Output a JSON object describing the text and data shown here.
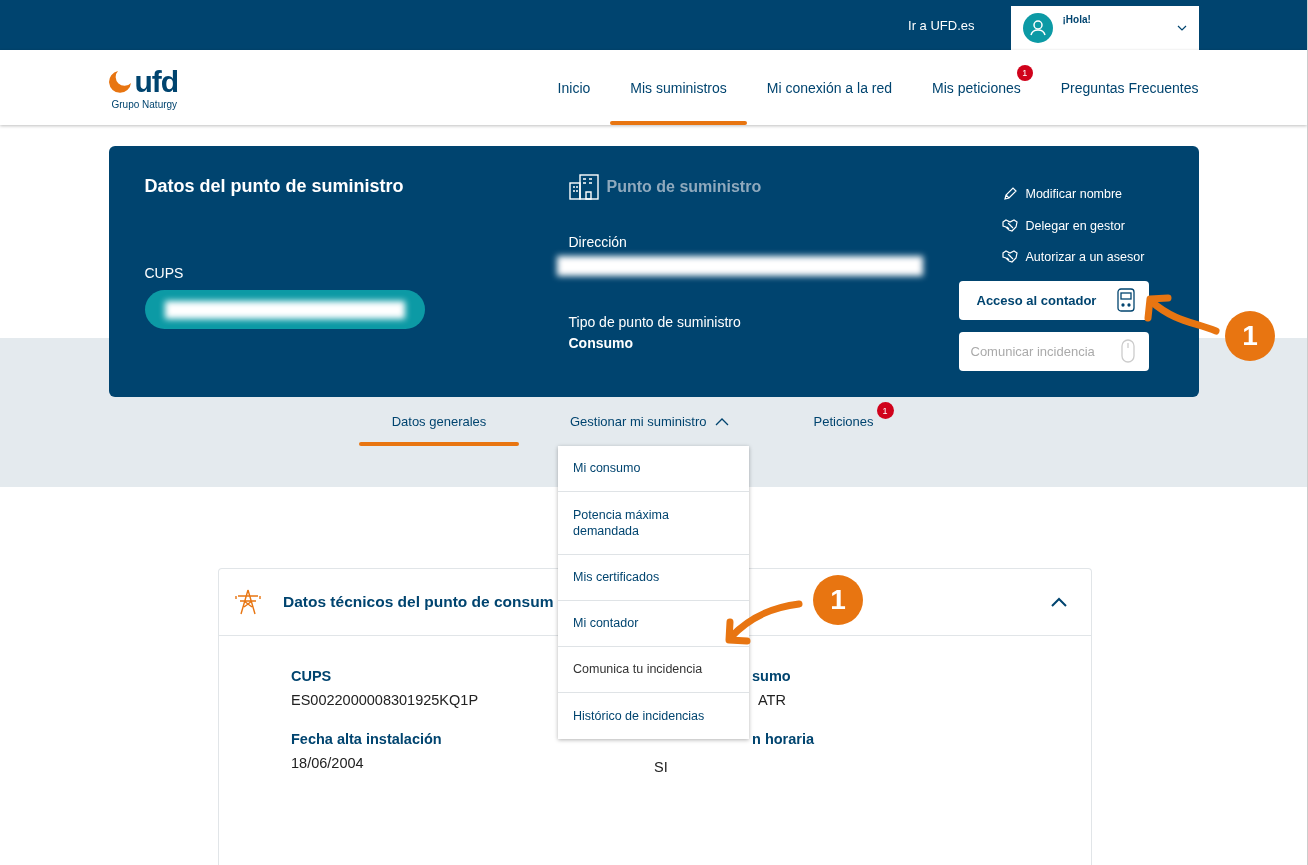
{
  "top_bar": {
    "link": "Ir a UFD.es",
    "greeting": "¡Hola!"
  },
  "logo": {
    "wordmark": "ufd",
    "subtitle": "Grupo Naturgy"
  },
  "nav": [
    {
      "label": "Inicio",
      "selected": false
    },
    {
      "label": "Mis suministros",
      "selected": true
    },
    {
      "label": "Mi conexión a la red",
      "selected": false
    },
    {
      "label": "Mis peticiones",
      "selected": false,
      "badge": "1"
    },
    {
      "label": "Preguntas Frecuentes",
      "selected": false
    }
  ],
  "supply_card": {
    "title": "Datos del punto de suministro",
    "cups_label": "CUPS",
    "point_heading": "Punto de suministro",
    "address_label": "Dirección",
    "type_label": "Tipo de punto de suministro",
    "type_value": "Consumo",
    "actions": [
      {
        "label": "Modificar nombre",
        "kind": "pencil"
      },
      {
        "label": "Delegar en gestor",
        "kind": "handshake"
      },
      {
        "label": "Autorizar a un asesor",
        "kind": "handshake"
      }
    ],
    "buttons": [
      {
        "label": "Acceso al contador",
        "kind": "meter",
        "disabled": false
      },
      {
        "label": "Comunicar incidencia",
        "kind": "mouse",
        "disabled": true
      }
    ]
  },
  "tabs": [
    {
      "label": "Datos generales",
      "selected": true
    },
    {
      "label": "Gestionar mi suministro",
      "selected": false,
      "expanded": true
    },
    {
      "label": "Peticiones",
      "selected": false,
      "badge": "1"
    }
  ],
  "dropdown": [
    {
      "label": "Mi consumo",
      "disabled": false
    },
    {
      "label": "Potencia máxima demandada",
      "disabled": false
    },
    {
      "label": "Mis certificados",
      "disabled": false
    },
    {
      "label": "Mi contador",
      "disabled": false
    },
    {
      "label": "Comunica tu incidencia",
      "disabled": true
    },
    {
      "label": "Histórico de incidencias",
      "disabled": false
    }
  ],
  "tech_section": {
    "title": "Datos técnicos del punto de consum",
    "expanded": true,
    "fields": [
      {
        "label": "CUPS",
        "value": "ES0022000008301925KQ1P"
      },
      {
        "label": "sumo",
        "value": "ATR"
      },
      {
        "label": "Fecha alta instalación",
        "value": "18/06/2004"
      },
      {
        "label": "n horaria",
        "value": "SI"
      }
    ]
  },
  "annotations": [
    {
      "number": "1"
    },
    {
      "number": "1"
    }
  ]
}
